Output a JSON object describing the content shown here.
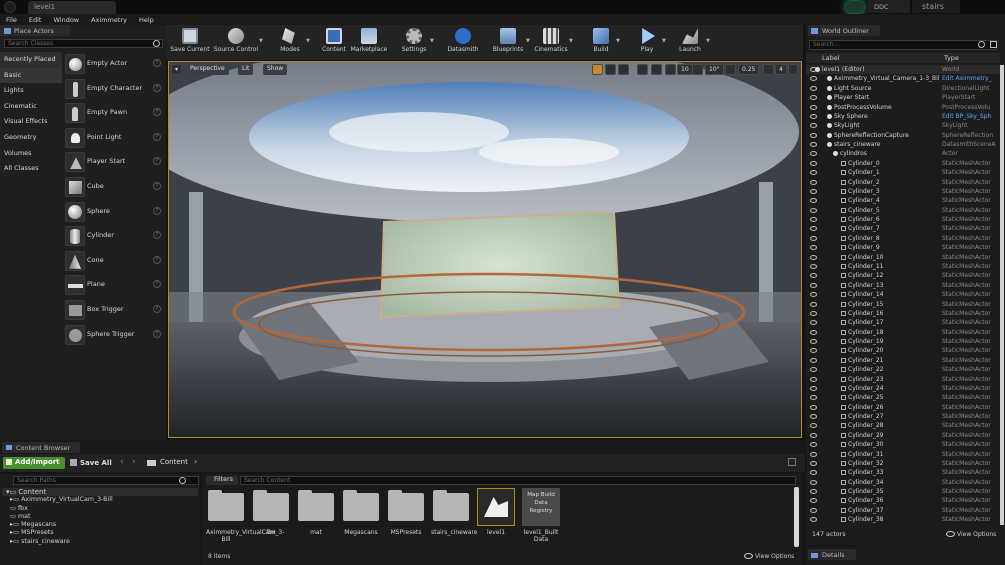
{
  "titlebar": {
    "tab": "level1",
    "ddc": "DDC",
    "project": "stairs"
  },
  "menu": [
    "File",
    "Edit",
    "Window",
    "Aximmetry",
    "Help"
  ],
  "place_actors": {
    "tab": "Place Actors",
    "search_placeholder": "Search Classes",
    "categories": [
      "Recently Placed",
      "Basic",
      "Lights",
      "Cinematic",
      "Visual Effects",
      "Geometry",
      "Volumes",
      "All Classes"
    ],
    "items": [
      "Empty Actor",
      "Empty Character",
      "Empty Pawn",
      "Point Light",
      "Player Start",
      "Cube",
      "Sphere",
      "Cylinder",
      "Cone",
      "Plane",
      "Box Trigger",
      "Sphere Trigger"
    ]
  },
  "toolbar": {
    "buttons": [
      "Save Current",
      "Source Control",
      "Modes",
      "Content",
      "Marketplace",
      "Settings",
      "Datasmith",
      "Blueprints",
      "Cinematics",
      "Build",
      "Play",
      "Launch"
    ]
  },
  "viewport": {
    "perspective": "Perspective",
    "lit": "Lit",
    "show": "Show",
    "grid": "10",
    "angle": "10°",
    "scale": "0.25",
    "cam_speed": "4"
  },
  "content_browser": {
    "tab": "Content Browser",
    "add_import": "Add/Import",
    "save_all": "Save All",
    "path": "Content",
    "search_paths": "Search Paths",
    "filters": "Filters",
    "search_content": "Search Content",
    "tree": [
      "Content",
      "Aximmetry_VirtualCam_3-Bill",
      "fbx",
      "mat",
      "Megascans",
      "MSPresets",
      "stairs_cineware"
    ],
    "assets": [
      "Aximmetry_VirtualCam_3-Bill",
      "fbx",
      "mat",
      "Megascans",
      "MSPresets",
      "stairs_cineware",
      "level1",
      "level1_Built Data"
    ],
    "registry_label": "Map Build Data Registry",
    "item_count": "8 items",
    "view_options": "View Options"
  },
  "outliner": {
    "tab": "World Outliner",
    "search_placeholder": "Search...",
    "col_label": "Label",
    "col_type": "Type",
    "rows": [
      {
        "label": "level1 (Editor)",
        "type": "World",
        "indent": 0
      },
      {
        "label": "Aximmetry_Virtual_Camera_1-3_Bil",
        "type": "Edit Aximmetry_",
        "indent": 1,
        "link": true
      },
      {
        "label": "Light Source",
        "type": "DirectionalLight",
        "indent": 1
      },
      {
        "label": "Player Start",
        "type": "PlayerStart",
        "indent": 1
      },
      {
        "label": "PostProcessVolume",
        "type": "PostProcessVolu",
        "indent": 1
      },
      {
        "label": "Sky Sphere",
        "type": "Edit BP_Sky_Sph",
        "indent": 1,
        "link": true
      },
      {
        "label": "SkyLight",
        "type": "SkyLight",
        "indent": 1
      },
      {
        "label": "SphereReflectionCapture",
        "type": "SphereReflection",
        "indent": 1
      },
      {
        "label": "stairs_cineware",
        "type": "DatasmithSceneA",
        "indent": 1
      },
      {
        "label": "cylindros",
        "type": "Actor",
        "indent": 2
      },
      {
        "label": "Cylinder_0",
        "type": "StaticMeshActor",
        "indent": 3
      },
      {
        "label": "Cylinder_1",
        "type": "StaticMeshActor",
        "indent": 3
      },
      {
        "label": "Cylinder_2",
        "type": "StaticMeshActor",
        "indent": 3
      },
      {
        "label": "Cylinder_3",
        "type": "StaticMeshActor",
        "indent": 3
      },
      {
        "label": "Cylinder_4",
        "type": "StaticMeshActor",
        "indent": 3
      },
      {
        "label": "Cylinder_5",
        "type": "StaticMeshActor",
        "indent": 3
      },
      {
        "label": "Cylinder_6",
        "type": "StaticMeshActor",
        "indent": 3
      },
      {
        "label": "Cylinder_7",
        "type": "StaticMeshActor",
        "indent": 3
      },
      {
        "label": "Cylinder_8",
        "type": "StaticMeshActor",
        "indent": 3
      },
      {
        "label": "Cylinder_9",
        "type": "StaticMeshActor",
        "indent": 3
      },
      {
        "label": "Cylinder_10",
        "type": "StaticMeshActor",
        "indent": 3
      },
      {
        "label": "Cylinder_11",
        "type": "StaticMeshActor",
        "indent": 3
      },
      {
        "label": "Cylinder_12",
        "type": "StaticMeshActor",
        "indent": 3
      },
      {
        "label": "Cylinder_13",
        "type": "StaticMeshActor",
        "indent": 3
      },
      {
        "label": "Cylinder_14",
        "type": "StaticMeshActor",
        "indent": 3
      },
      {
        "label": "Cylinder_15",
        "type": "StaticMeshActor",
        "indent": 3
      },
      {
        "label": "Cylinder_16",
        "type": "StaticMeshActor",
        "indent": 3
      },
      {
        "label": "Cylinder_17",
        "type": "StaticMeshActor",
        "indent": 3
      },
      {
        "label": "Cylinder_18",
        "type": "StaticMeshActor",
        "indent": 3
      },
      {
        "label": "Cylinder_19",
        "type": "StaticMeshActor",
        "indent": 3
      },
      {
        "label": "Cylinder_20",
        "type": "StaticMeshActor",
        "indent": 3
      },
      {
        "label": "Cylinder_21",
        "type": "StaticMeshActor",
        "indent": 3
      },
      {
        "label": "Cylinder_22",
        "type": "StaticMeshActor",
        "indent": 3
      },
      {
        "label": "Cylinder_23",
        "type": "StaticMeshActor",
        "indent": 3
      },
      {
        "label": "Cylinder_24",
        "type": "StaticMeshActor",
        "indent": 3
      },
      {
        "label": "Cylinder_25",
        "type": "StaticMeshActor",
        "indent": 3
      },
      {
        "label": "Cylinder_26",
        "type": "StaticMeshActor",
        "indent": 3
      },
      {
        "label": "Cylinder_27",
        "type": "StaticMeshActor",
        "indent": 3
      },
      {
        "label": "Cylinder_28",
        "type": "StaticMeshActor",
        "indent": 3
      },
      {
        "label": "Cylinder_29",
        "type": "StaticMeshActor",
        "indent": 3
      },
      {
        "label": "Cylinder_30",
        "type": "StaticMeshActor",
        "indent": 3
      },
      {
        "label": "Cylinder_31",
        "type": "StaticMeshActor",
        "indent": 3
      },
      {
        "label": "Cylinder_32",
        "type": "StaticMeshActor",
        "indent": 3
      },
      {
        "label": "Cylinder_33",
        "type": "StaticMeshActor",
        "indent": 3
      },
      {
        "label": "Cylinder_34",
        "type": "StaticMeshActor",
        "indent": 3
      },
      {
        "label": "Cylinder_35",
        "type": "StaticMeshActor",
        "indent": 3
      },
      {
        "label": "Cylinder_36",
        "type": "StaticMeshActor",
        "indent": 3
      },
      {
        "label": "Cylinder_37",
        "type": "StaticMeshActor",
        "indent": 3
      },
      {
        "label": "Cylinder_38",
        "type": "StaticMeshActor",
        "indent": 3
      }
    ],
    "actor_count": "147 actors",
    "view_options": "View Options"
  },
  "details": {
    "tab": "Details"
  },
  "colors": {
    "accent": "#b88a1a",
    "link": "#5fa8ff",
    "add_import": "#4a8f2f"
  }
}
